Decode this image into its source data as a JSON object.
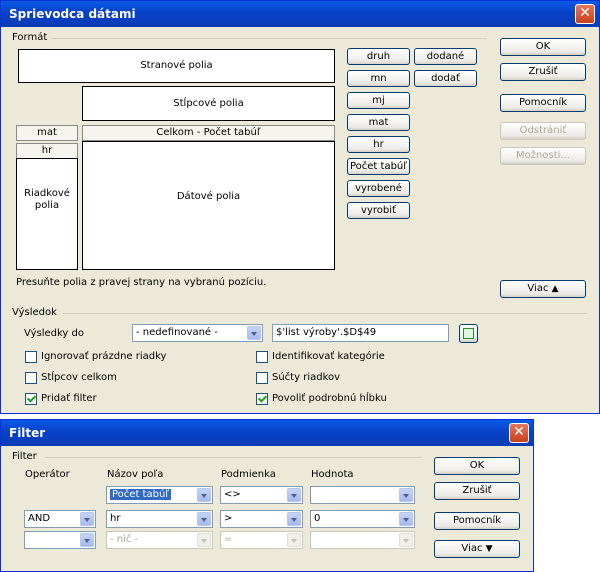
{
  "pilot": {
    "title": "Sprievodca dátami",
    "format_label": "Formát",
    "zones": {
      "page": "Stranové polia",
      "column": "Stĺpcové polia",
      "row": "Riadkové polia",
      "data": "Dátové polia"
    },
    "row_fields": [
      "mat",
      "hr"
    ],
    "data_field": "Celkom - Počet tabúľ",
    "available_col1": [
      "druh",
      "mn",
      "mj",
      "mat",
      "hr",
      "Počet tabúľ",
      "vyrobené",
      "vyrobiť"
    ],
    "available_col2": [
      "dodané",
      "dodať"
    ],
    "hint": "Presuňte polia z pravej strany na vybranú pozíciu.",
    "buttons": {
      "ok": "OK",
      "cancel": "Zrušiť",
      "help": "Pomocník",
      "remove": "Odstrániť",
      "options": "Možnosti...",
      "more": "Viac"
    },
    "result_label": "Výsledok",
    "results_to_label": "Výsledky do",
    "results_to_value": "- nedefinované -",
    "results_target": "$'list výroby'.$D$49",
    "checks": {
      "ignore_empty": "Ignorovať prázdne riadky",
      "identify_categories": "Identifikovať kategórie",
      "total_columns": "Stĺpcov celkom",
      "total_rows": "Súčty riadkov",
      "add_filter": "Pridať filter",
      "drill_down": "Povoliť podrobnú hĺbku"
    }
  },
  "filter": {
    "title": "Filter",
    "group_label": "Filter",
    "headers": {
      "operator": "Operátor",
      "field": "Názov poľa",
      "condition": "Podmienka",
      "value": "Hodnota"
    },
    "rows": [
      {
        "operator": "",
        "field": "Počet tabúľ",
        "condition": "<>",
        "value": ""
      },
      {
        "operator": "AND",
        "field": "hr",
        "condition": ">",
        "value": "0"
      },
      {
        "operator": "",
        "field": "- nič -",
        "condition": "=",
        "value": ""
      }
    ],
    "buttons": {
      "ok": "OK",
      "cancel": "Zrušiť",
      "help": "Pomocník",
      "more": "Viac"
    }
  },
  "colors": {
    "title_bar": "#0a47d6",
    "dialog_bg": "#ece9d8",
    "close": "#d0502e",
    "selection": "#316ac5"
  }
}
